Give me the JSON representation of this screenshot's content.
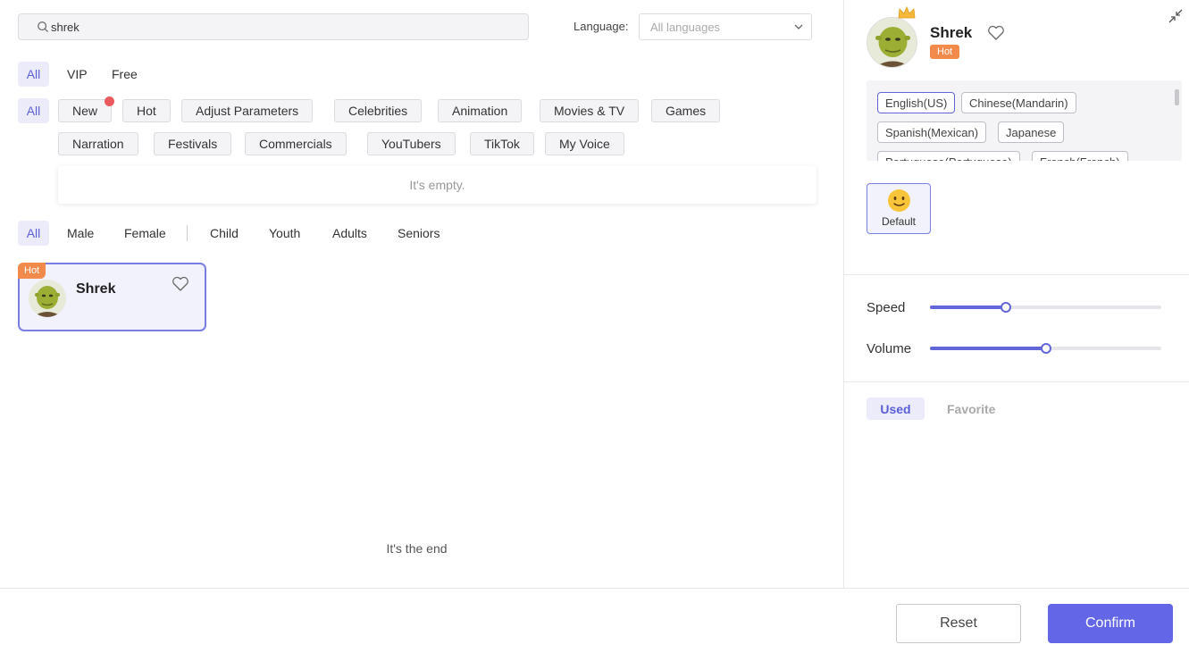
{
  "search": {
    "value": "shrek"
  },
  "language_filter": {
    "label": "Language:",
    "placeholder": "All languages"
  },
  "tier_tabs": {
    "all": "All",
    "vip": "VIP",
    "free": "Free"
  },
  "categories": {
    "all": "All",
    "items": [
      "New",
      "Hot",
      "Adjust Parameters",
      "Celebrities",
      "Animation",
      "Movies & TV",
      "Games",
      "Narration",
      "Festivals",
      "Commercials",
      "YouTubers",
      "TikTok",
      "My Voice"
    ]
  },
  "empty_message": "It's empty.",
  "demographic_tabs": {
    "all": "All",
    "male": "Male",
    "female": "Female",
    "child": "Child",
    "youth": "Youth",
    "adults": "Adults",
    "seniors": "Seniors"
  },
  "voice_card": {
    "tag": "Hot",
    "name": "Shrek"
  },
  "end_message": "It's the end",
  "detail": {
    "name": "Shrek",
    "tag": "Hot",
    "languages": [
      "English(US)",
      "Chinese(Mandarin)",
      "Spanish(Mexican)",
      "Japanese",
      "Portuguese(Portuguese)",
      "French(French)"
    ],
    "emotion": "Default",
    "speed_label": "Speed",
    "speed_value": 0.33,
    "volume_label": "Volume",
    "volume_value": 0.5,
    "tab_used": "Used",
    "tab_favorite": "Favorite"
  },
  "footer": {
    "reset": "Reset",
    "confirm": "Confirm"
  },
  "colors": {
    "accent": "#6366e6",
    "hot": "#f18a4a",
    "new_dot": "#ea5a5e"
  }
}
